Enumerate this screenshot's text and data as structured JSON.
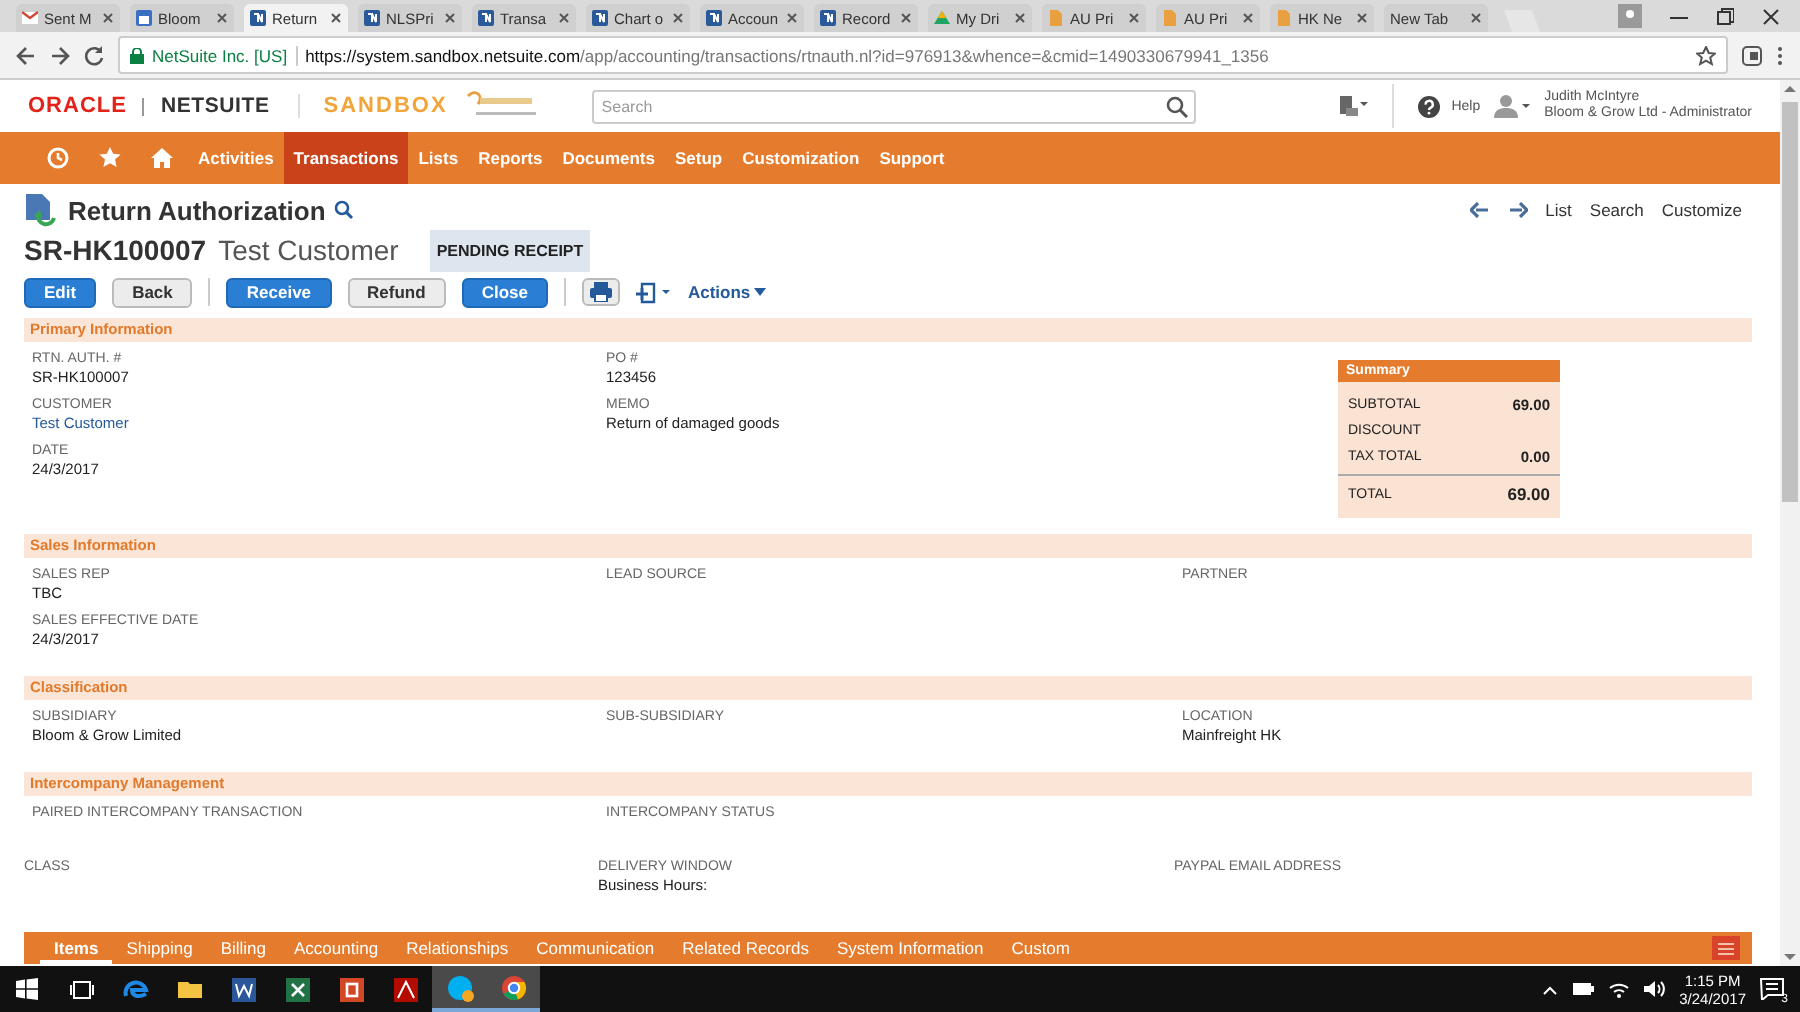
{
  "browser": {
    "tabs": [
      {
        "label": "Sent M",
        "selected": false,
        "kind": "mail"
      },
      {
        "label": "Bloom",
        "selected": false,
        "kind": "calendar"
      },
      {
        "label": "Return",
        "selected": true,
        "kind": "netsuite"
      },
      {
        "label": "NLSPri",
        "selected": false,
        "kind": "netsuite"
      },
      {
        "label": "Transa",
        "selected": false,
        "kind": "netsuite"
      },
      {
        "label": "Chart o",
        "selected": false,
        "kind": "netsuite"
      },
      {
        "label": "Accoun",
        "selected": false,
        "kind": "netsuite"
      },
      {
        "label": "Record",
        "selected": false,
        "kind": "netsuite"
      },
      {
        "label": "My Dri",
        "selected": false,
        "kind": "drive"
      },
      {
        "label": "AU Pri",
        "selected": false,
        "kind": "document"
      },
      {
        "label": "AU Pri",
        "selected": false,
        "kind": "document"
      },
      {
        "label": "HK Ne",
        "selected": false,
        "kind": "document"
      },
      {
        "label": "New Tab",
        "selected": false,
        "kind": "blank"
      }
    ],
    "site": "NetSuite Inc. [US]",
    "url_host": "https://system.sandbox.netsuite.com",
    "url_path": "/app/accounting/transactions/rtnauth.nl?id=976913&whence=&cmid=1490330679941_1356"
  },
  "header": {
    "brand": "ORACLE",
    "product": "NETSUITE",
    "environment": "SANDBOX",
    "search": {
      "placeholder": "Search"
    },
    "help": "Help",
    "user": {
      "name": "Judith McIntyre",
      "role": "Bloom & Grow Ltd - Administrator"
    }
  },
  "nav": [
    {
      "label": "Activities",
      "selected": false
    },
    {
      "label": "Transactions",
      "selected": true
    },
    {
      "label": "Lists",
      "selected": false
    },
    {
      "label": "Reports",
      "selected": false
    },
    {
      "label": "Documents",
      "selected": false
    },
    {
      "label": "Setup",
      "selected": false
    },
    {
      "label": "Customization",
      "selected": false
    },
    {
      "label": "Support",
      "selected": false
    }
  ],
  "record": {
    "type": "Return Authorization",
    "number": "SR-HK100007",
    "entity": "Test Customer",
    "status": "PENDING RECEIPT",
    "links": [
      "List",
      "Search",
      "Customize"
    ],
    "buttons": [
      {
        "label": "Edit",
        "kind": "primary"
      },
      {
        "label": "Back",
        "kind": "secondary"
      },
      {
        "label": "Receive",
        "kind": "primary"
      },
      {
        "label": "Refund",
        "kind": "secondary"
      },
      {
        "label": "Close",
        "kind": "primary"
      }
    ],
    "actions": "Actions"
  },
  "sections": [
    {
      "title": "Primary Information",
      "columns": [
        [
          {
            "label": "RTN. AUTH. #",
            "value": "SR-HK100007"
          },
          {
            "label": "CUSTOMER",
            "value": "Test Customer",
            "kind": "link"
          },
          {
            "label": "DATE",
            "value": "24/3/2017"
          }
        ],
        [
          {
            "label": "PO #",
            "value": "123456"
          },
          {
            "label": "MEMO",
            "value": "Return of damaged goods"
          }
        ]
      ],
      "summary": {
        "title": "Summary",
        "rows": [
          {
            "label": "SUBTOTAL",
            "value": "69.00"
          },
          {
            "label": "DISCOUNT"
          },
          {
            "label": "TAX TOTAL",
            "value": "0.00"
          }
        ],
        "total": {
          "label": "TOTAL",
          "value": "69.00"
        }
      }
    },
    {
      "title": "Sales Information",
      "columns": [
        [
          {
            "label": "SALES REP",
            "value": "TBC"
          },
          {
            "label": "SALES EFFECTIVE DATE",
            "value": "24/3/2017"
          }
        ],
        [
          {
            "label": "LEAD SOURCE"
          }
        ],
        [
          {
            "label": "PARTNER"
          }
        ]
      ]
    },
    {
      "title": "Classification",
      "columns": [
        [
          {
            "label": "SUBSIDIARY",
            "value": "Bloom & Grow Limited"
          }
        ],
        [
          {
            "label": "SUB-SUBSIDIARY"
          }
        ],
        [
          {
            "label": "LOCATION",
            "value": "Mainfreight HK"
          }
        ]
      ]
    },
    {
      "title": "Intercompany Management",
      "columns": [
        [
          {
            "label": "PAIRED INTERCOMPANY TRANSACTION"
          }
        ],
        [
          {
            "label": "INTERCOMPANY STATUS"
          }
        ]
      ]
    },
    {
      "columns": [
        [
          {
            "label": "CLASS"
          }
        ],
        [
          {
            "label": "DELIVERY WINDOW",
            "value": "Business Hours:"
          }
        ],
        [
          {
            "label": "PAYPAL EMAIL ADDRESS"
          }
        ]
      ]
    }
  ],
  "subtabs": [
    {
      "label": "Items",
      "selected": true
    },
    {
      "label": "Shipping",
      "selected": false
    },
    {
      "label": "Billing",
      "selected": false
    },
    {
      "label": "Accounting",
      "selected": false
    },
    {
      "label": "Relationships",
      "selected": false
    },
    {
      "label": "Communication",
      "selected": false
    },
    {
      "label": "Related Records",
      "selected": false
    },
    {
      "label": "System Information",
      "selected": false
    },
    {
      "label": "Custom",
      "selected": false
    }
  ],
  "taskbar": {
    "apps": [
      {
        "kind": "edge",
        "selected": false
      },
      {
        "kind": "explorer",
        "selected": false
      },
      {
        "kind": "word",
        "selected": false
      },
      {
        "kind": "excel",
        "selected": false
      },
      {
        "kind": "powerpoint",
        "selected": false
      },
      {
        "kind": "acrobat",
        "selected": false
      },
      {
        "kind": "skype",
        "selected": true
      },
      {
        "kind": "chrome",
        "selected": true
      }
    ],
    "time": "1:15 PM",
    "date": "3/24/2017",
    "notifications": "3"
  }
}
